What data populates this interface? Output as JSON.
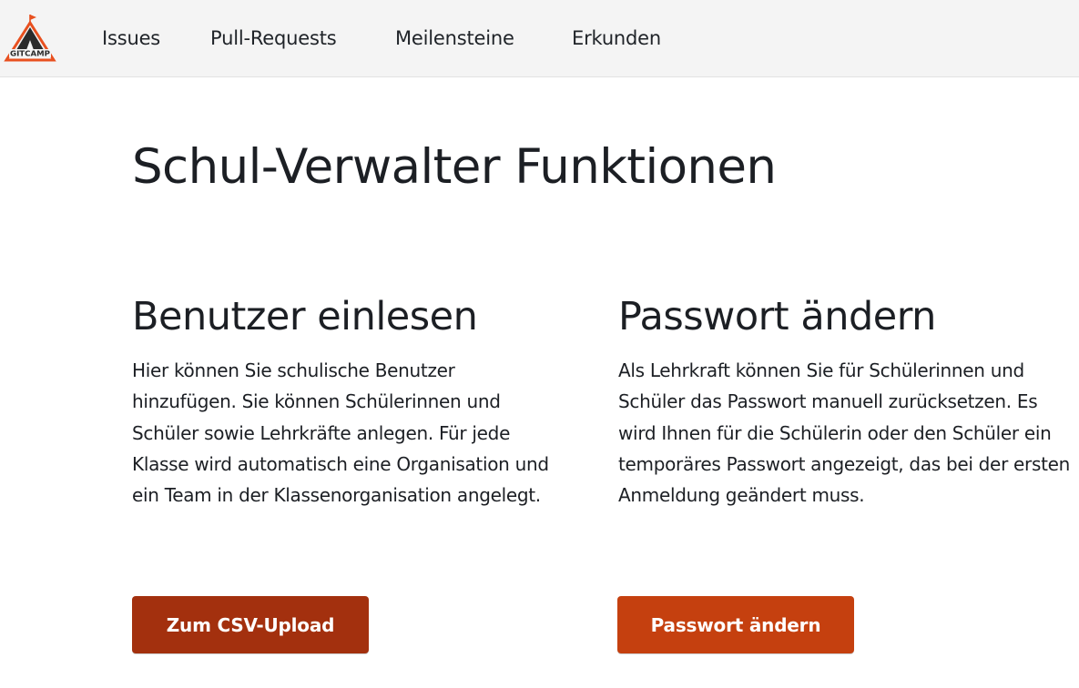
{
  "nav": {
    "logo_text": "GITCAMP",
    "links": [
      "Issues",
      "Pull-Requests",
      "Meilensteine",
      "Erkunden"
    ]
  },
  "page": {
    "title": "Schul-Verwalter Funktionen"
  },
  "cards": [
    {
      "title": "Benutzer einlesen",
      "text": "Hier können Sie schulische Benutzer hinzufügen. Sie können Schülerinnen und Schüler sowie Lehrkräfte anlegen. Für jede Klasse wird automatisch eine Organisation und ein Team in der Klassenorganisation angelegt.",
      "button": "Zum CSV-Upload",
      "button_color": "#a3300e"
    },
    {
      "title": "Passwort ändern",
      "text": "Als Lehrkraft können Sie für Schülerinnen und Schüler das Passwort manuell zurücksetzen. Es wird Ihnen für die Schülerin oder den Schüler ein temporäres Passwort angezeigt, das bei der ersten Anmeldung geändert muss.",
      "button": "Passwort ändern",
      "button_color": "#c5400f"
    }
  ],
  "colors": {
    "navbar_bg": "#f4f4f4",
    "brand_orange": "#e8501f",
    "logo_dark": "#2b2b2b"
  }
}
